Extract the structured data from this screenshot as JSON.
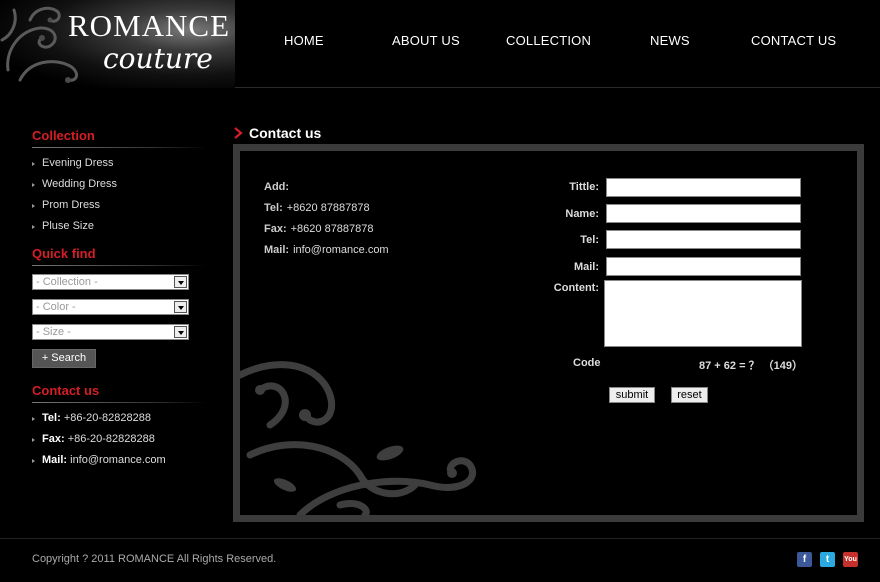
{
  "logo": {
    "line1": "ROMANCE",
    "line2": "couture"
  },
  "nav": [
    "HOME",
    "ABOUT US",
    "COLLECTION",
    "NEWS",
    "CONTACT US"
  ],
  "sidebar": {
    "collection_title": "Collection",
    "collection_items": [
      "Evening Dress",
      "Wedding Dress",
      "Prom Dress",
      "Pluse Size"
    ],
    "quickfind_title": "Quick find",
    "selects": [
      "- Collection -",
      "- Color -",
      "- Size -"
    ],
    "search_label": "+ Search",
    "contact_title": "Contact us",
    "contact": [
      {
        "label": "Tel:",
        "value": "+86-20-82828288"
      },
      {
        "label": "Fax:",
        "value": "+86-20-82828288"
      },
      {
        "label": "Mail:",
        "value": "info@romance.com"
      }
    ]
  },
  "main": {
    "title": "Contact us",
    "info": [
      {
        "label": "Add:",
        "value": ""
      },
      {
        "label": "Tel:",
        "value": "+8620 87887878"
      },
      {
        "label": "Fax:",
        "value": "+8620 87887878"
      },
      {
        "label": "Mail:",
        "value": "info@romance.com"
      }
    ],
    "form": {
      "title_label": "Tittle:",
      "name_label": "Name:",
      "tel_label": "Tel:",
      "mail_label": "Mail:",
      "content_label": "Content:",
      "code_label": "Code",
      "captcha": "87 + 62 = ？ （149）",
      "submit_label": "submit",
      "reset_label": "reset"
    }
  },
  "footer": {
    "copyright": "Copyright ? 2011 ROMANCE All Rights Reserved.",
    "social_icons": [
      "facebook-icon",
      "twitter-icon",
      "youtube-icon"
    ]
  },
  "colors": {
    "accent": "#d41f26",
    "panel_border": "#3b3b3b",
    "background": "#000000"
  }
}
